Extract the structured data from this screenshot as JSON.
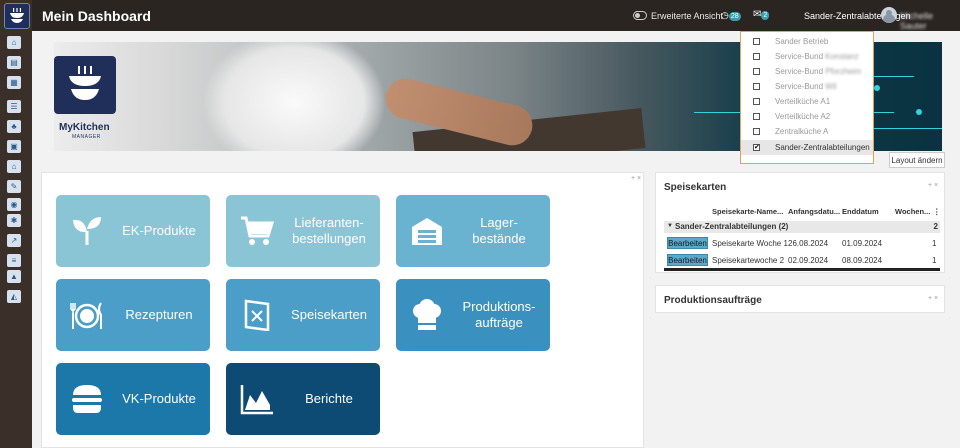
{
  "header": {
    "title": "Mein Dashboard",
    "extended_view_label": "Erweiterte Ansicht",
    "clock_badge": "28",
    "chat_badge": "2",
    "department": "Sander-Zentralabteilungen",
    "user_name": "Michelle Sauter"
  },
  "banner": {
    "brand_name": "MyKitchen",
    "brand_sub": "MANAGER"
  },
  "layout_button": "Layout ändern",
  "tiles": [
    {
      "label": "EK-Produkte",
      "color": "#8ac5d6",
      "icon": "sprout-icon"
    },
    {
      "label": "Lieferanten-\nbestellungen",
      "color": "#8ac5d6",
      "icon": "cart-icon"
    },
    {
      "label": "Lager-\nbestände",
      "color": "#6ab3d0",
      "icon": "warehouse-icon"
    },
    {
      "label": "Rezepturen",
      "color": "#4a9ec7",
      "icon": "plate-cutlery-icon"
    },
    {
      "label": "Speisekarten",
      "color": "#4a9ec7",
      "icon": "menu-card-icon"
    },
    {
      "label": "Produktions-\naufträge",
      "color": "#3a90bf",
      "icon": "chef-hat-icon"
    },
    {
      "label": "VK-Produkte",
      "color": "#1b78a8",
      "icon": "burger-icon"
    },
    {
      "label": "Berichte",
      "color": "#0d4a74",
      "icon": "area-chart-icon"
    }
  ],
  "speisekarten": {
    "title": "Speisekarten",
    "columns": [
      "Speisekarte-Name...",
      "Anfangsdatu...",
      "Enddatum",
      "Wochen...",
      "⋮"
    ],
    "group": {
      "label": "Sander-Zentralabteilungen (2)",
      "count": "2"
    },
    "edit_label": "Bearbeiten",
    "rows": [
      {
        "name": "Speisekarte Woche 1",
        "start": "26.08.2024",
        "end": "01.09.2024",
        "weeks": "1"
      },
      {
        "name": "Speisekartewoche 2",
        "start": "02.09.2024",
        "end": "08.09.2024",
        "weeks": "1"
      }
    ]
  },
  "produktion": {
    "title": "Produktionsaufträge"
  },
  "panel_controls": "+ ×",
  "dropdown": {
    "items": [
      {
        "label": "Sander Betrieb",
        "blur": "",
        "checked": false
      },
      {
        "label": "Service-Bund",
        "blur": "Konstanz",
        "checked": false
      },
      {
        "label": "Service-Bund",
        "blur": "Pforzheim",
        "checked": false
      },
      {
        "label": "Service-Bund",
        "blur": "Wil",
        "checked": false
      },
      {
        "label": "Verteilküche A1",
        "blur": "",
        "checked": false
      },
      {
        "label": "Verteilküche A2",
        "blur": "",
        "checked": false
      },
      {
        "label": "Zentralküche A",
        "blur": "",
        "checked": false
      },
      {
        "label": "Sander-Zentralabteilungen",
        "blur": "",
        "checked": true
      }
    ]
  }
}
